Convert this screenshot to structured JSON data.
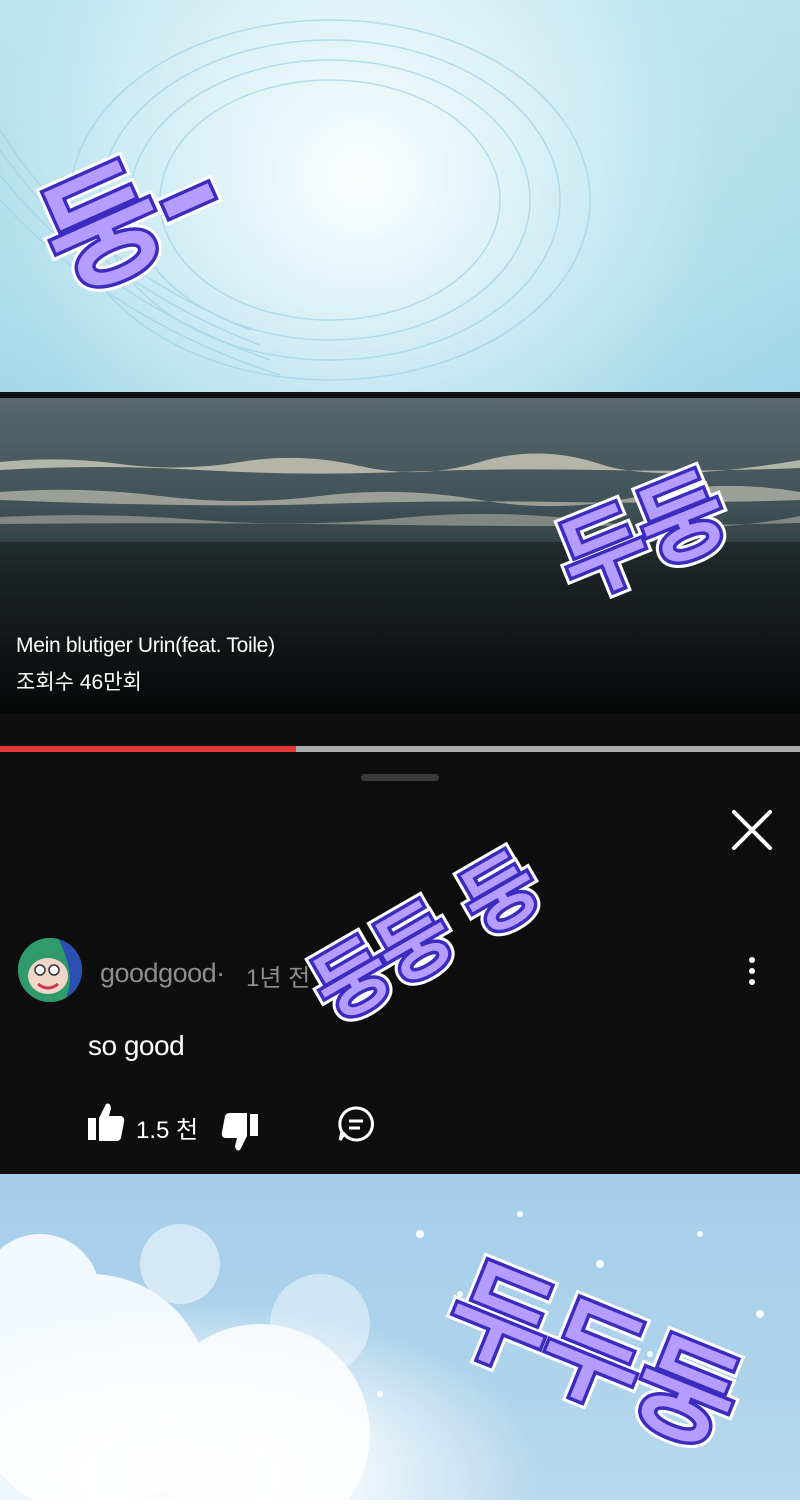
{
  "video": {
    "title": "Mein blutiger Urin(feat. Toile)",
    "views": "조회수 46만회",
    "progress": 0.37
  },
  "comment": {
    "username": "goodgood·",
    "time": "1년 전",
    "text": "so good",
    "like_count": "1.5 천"
  },
  "sound_effects": [
    "둥–",
    "두둥",
    "둥둥 둥",
    "두두둥"
  ],
  "icons": {
    "close": "close-icon",
    "more": "more-vert-icon",
    "like": "thumbs-up-icon",
    "dislike": "thumbs-down-icon",
    "reply": "comment-reply-icon"
  },
  "colors": {
    "progress_fill": "#e53935",
    "progress_track": "#aaaaaa",
    "sfx_fill": "#b59cff",
    "sfx_outline": "#3b2bbf"
  }
}
